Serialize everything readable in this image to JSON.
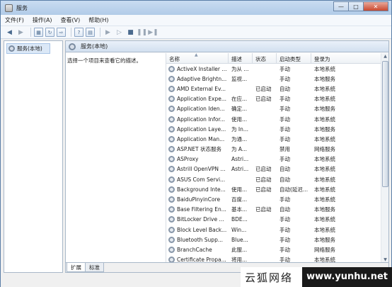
{
  "window": {
    "title": "服务"
  },
  "menu": [
    "文件(F)",
    "操作(A)",
    "查看(V)",
    "帮助(H)"
  ],
  "tree": {
    "root_label": "服务(本地)"
  },
  "pane": {
    "header": "服务(本地)",
    "description_hint": "选择一个项目来查看它的描述。"
  },
  "columns": {
    "name": "名称",
    "desc": "描述",
    "status": "状态",
    "startup": "启动类型",
    "login": "登录为"
  },
  "services": [
    {
      "name": "ActiveX Installer ...",
      "desc": "为从 ...",
      "status": "",
      "startup": "手动",
      "login": "本地系统"
    },
    {
      "name": "Adaptive Brightn...",
      "desc": "监视...",
      "status": "",
      "startup": "手动",
      "login": "本地服务"
    },
    {
      "name": "AMD External Ev...",
      "desc": "",
      "status": "已启动",
      "startup": "自动",
      "login": "本地系统"
    },
    {
      "name": "Application Expe...",
      "desc": "在应...",
      "status": "已启动",
      "startup": "手动",
      "login": "本地系统"
    },
    {
      "name": "Application Iden...",
      "desc": "确定...",
      "status": "",
      "startup": "手动",
      "login": "本地服务"
    },
    {
      "name": "Application Infor...",
      "desc": "使用...",
      "status": "",
      "startup": "手动",
      "login": "本地系统"
    },
    {
      "name": "Application Laye...",
      "desc": "为 In...",
      "status": "",
      "startup": "手动",
      "login": "本地服务"
    },
    {
      "name": "Application Man...",
      "desc": "为通...",
      "status": "",
      "startup": "手动",
      "login": "本地系统"
    },
    {
      "name": "ASP.NET 状态服务",
      "desc": "为 A...",
      "status": "",
      "startup": "禁用",
      "login": "网络服务"
    },
    {
      "name": "ASProxy",
      "desc": "Astri...",
      "status": "",
      "startup": "手动",
      "login": "本地系统"
    },
    {
      "name": "Astrill OpenVPN ...",
      "desc": "Astri...",
      "status": "已启动",
      "startup": "自动",
      "login": "本地系统"
    },
    {
      "name": "ASUS Com Servi...",
      "desc": "",
      "status": "已启动",
      "startup": "自动",
      "login": "本地系统"
    },
    {
      "name": "Background Inte...",
      "desc": "使用...",
      "status": "已启动",
      "startup": "自动(延迟...",
      "login": "本地系统"
    },
    {
      "name": "BaiduPinyinCore",
      "desc": "百度...",
      "status": "",
      "startup": "手动",
      "login": "本地系统"
    },
    {
      "name": "Base Filtering En...",
      "desc": "基本...",
      "status": "已启动",
      "startup": "自动",
      "login": "本地服务"
    },
    {
      "name": "BitLocker Drive ...",
      "desc": "BDE...",
      "status": "",
      "startup": "手动",
      "login": "本地系统"
    },
    {
      "name": "Block Level Back...",
      "desc": "Win...",
      "status": "",
      "startup": "手动",
      "login": "本地系统"
    },
    {
      "name": "Bluetooth Supp...",
      "desc": "Blue...",
      "status": "",
      "startup": "手动",
      "login": "本地服务"
    },
    {
      "name": "BranchCache",
      "desc": "此服...",
      "status": "",
      "startup": "手动",
      "login": "网络服务"
    },
    {
      "name": "Certificate Propa...",
      "desc": "将用...",
      "status": "",
      "startup": "手动",
      "login": "本地系统"
    }
  ],
  "tabs": [
    "扩展",
    "标准"
  ],
  "watermark": {
    "cn": "云狐网络",
    "url": "www.yunhu.net"
  }
}
